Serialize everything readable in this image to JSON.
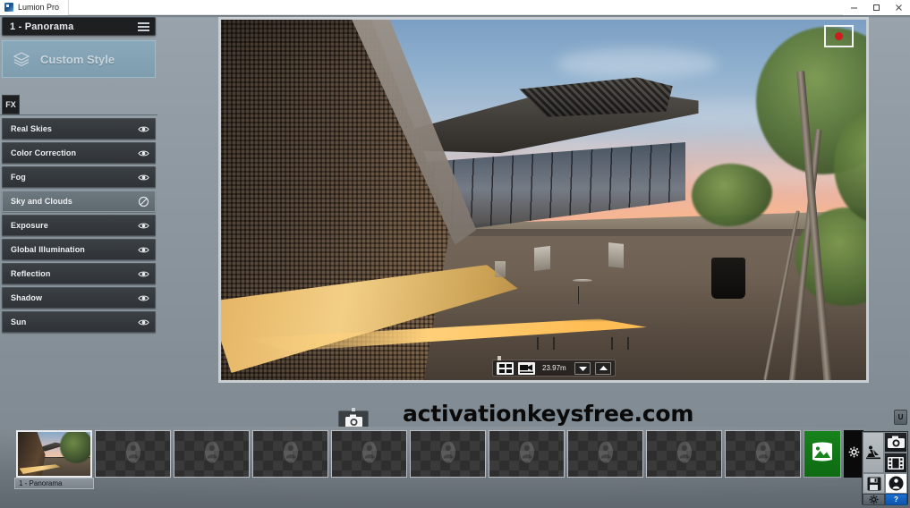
{
  "window": {
    "app_title": "Lumion Pro",
    "app_icon": "lumion-logo-icon",
    "minimize_label": "–",
    "maximize_label": "❐",
    "close_label": "✕"
  },
  "left_panel": {
    "header_title": "1 - Panorama",
    "menu_icon": "hamburger-menu-icon",
    "style_card": {
      "label": "Custom Style",
      "icon": "layered-style-icon"
    },
    "fx_tab_label": "FX",
    "effects": [
      {
        "label": "Real Skies",
        "visible": true,
        "icon": "eye-icon"
      },
      {
        "label": "Color Correction",
        "visible": true,
        "icon": "eye-icon"
      },
      {
        "label": "Fog",
        "visible": true,
        "icon": "eye-icon"
      },
      {
        "label": "Sky and Clouds",
        "visible": false,
        "icon": "eye-disabled-icon"
      },
      {
        "label": "Exposure",
        "visible": true,
        "icon": "eye-icon"
      },
      {
        "label": "Global Illumination",
        "visible": true,
        "icon": "eye-icon"
      },
      {
        "label": "Reflection",
        "visible": true,
        "icon": "eye-icon"
      },
      {
        "label": "Shadow",
        "visible": true,
        "icon": "eye-icon"
      },
      {
        "label": "Sun",
        "visible": true,
        "icon": "eye-icon"
      }
    ]
  },
  "viewport": {
    "record_indicator_icon": "record-frame-icon",
    "hud": {
      "split_view_icon": "split-view-icon",
      "camera_height_icon": "video-camera-icon",
      "height_value": "23.97m",
      "decrease_icon": "chevron-down-icon",
      "increase_icon": "chevron-up-icon"
    }
  },
  "watermark": {
    "text": "activationkeysfree.com"
  },
  "bottom": {
    "camera_tab_icon": "camera-icon",
    "update_button_label": "U",
    "slots": [
      {
        "label": "1 - Panorama",
        "filled": true
      },
      {
        "label": "",
        "filled": false
      },
      {
        "label": "",
        "filled": false
      },
      {
        "label": "",
        "filled": false
      },
      {
        "label": "",
        "filled": false
      },
      {
        "label": "",
        "filled": false
      },
      {
        "label": "",
        "filled": false
      },
      {
        "label": "",
        "filled": false
      },
      {
        "label": "",
        "filled": false
      },
      {
        "label": "",
        "filled": false
      }
    ],
    "empty_slot_icon": "panorama-person-ghost-icon",
    "render_button_icon": "panorama-image-icon",
    "render_settings_icon": "gear-icon",
    "tools": [
      {
        "name": "build-mode",
        "icon": "build-person-icon",
        "selected": false
      },
      {
        "name": "photo-mode",
        "icon": "photo-camera-icon",
        "selected": false
      },
      {
        "name": "movie-mode",
        "icon": "film-strip-icon",
        "selected": false
      },
      {
        "name": "file-mode",
        "icon": "floppy-disk-icon",
        "selected": false
      },
      {
        "name": "panorama-mode",
        "icon": "person-circle-icon",
        "selected": true
      }
    ],
    "settings_icon": "gear-icon",
    "help_label": "?"
  },
  "colors": {
    "accent_green": "#17831b",
    "accent_blue": "#1c6fd0",
    "panel_blue": "#89a9bb",
    "record_red": "#cf1d1d"
  }
}
